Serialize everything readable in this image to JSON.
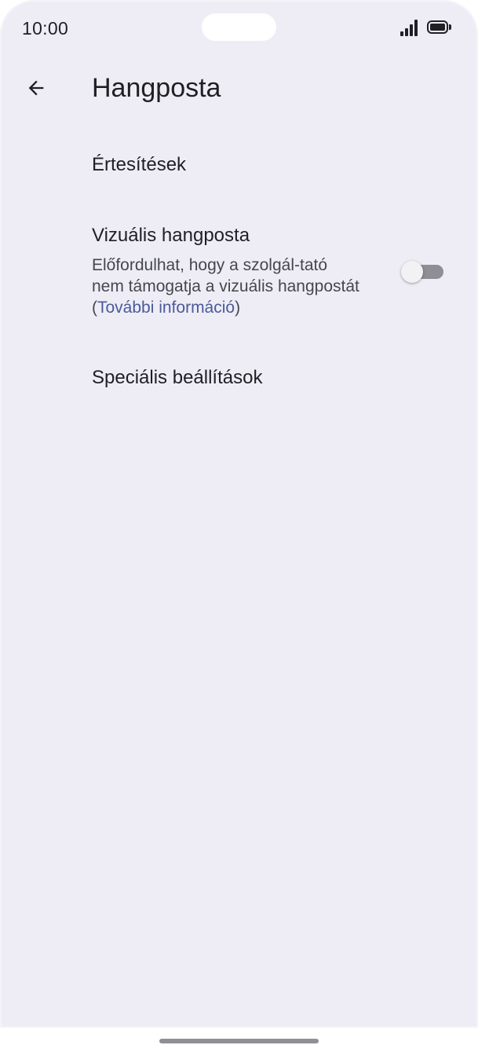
{
  "status_bar": {
    "time": "10:00",
    "signal_icon": "signal-icon",
    "battery_icon": "battery-icon"
  },
  "app_bar": {
    "back_icon": "arrow-back-icon",
    "title": "Hangposta"
  },
  "settings": {
    "items": [
      {
        "title": "Értesítések"
      },
      {
        "title": "Vizuális hangposta",
        "summary_prefix": "Előfordulhat, hogy a szolgál-tató nem támogatja a vizuális hangpostát (",
        "summary_link": "További információ",
        "summary_suffix": ")",
        "toggle_state": "off"
      },
      {
        "title": "Speciális beállítások"
      }
    ]
  },
  "colors": {
    "background": "#eeedf5",
    "link": "#4a5a9a",
    "text_primary": "#1f1f24",
    "text_secondary": "#46464f"
  }
}
